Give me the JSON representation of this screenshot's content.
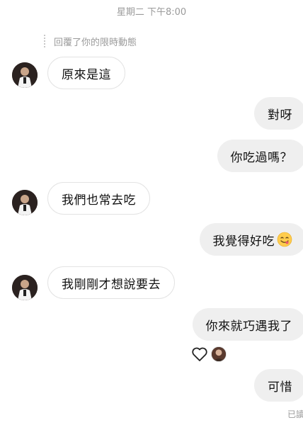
{
  "header": {
    "timestamp": "星期二 下午8:00"
  },
  "reply_note": "回覆了你的限時動態",
  "messages": [
    {
      "side": "in",
      "text": "原來是這"
    },
    {
      "side": "out",
      "text": "對呀"
    },
    {
      "side": "out",
      "text": "你吃過嗎？"
    },
    {
      "side": "in",
      "text": "我們也常去吃"
    },
    {
      "side": "out",
      "text": "我覺得好吃",
      "emoji": "yum-face-emoji"
    },
    {
      "side": "in",
      "text": "我剛剛才想說要去"
    },
    {
      "side": "out",
      "text": "你來就巧遇我了"
    },
    {
      "side": "out",
      "text": "可惜"
    }
  ],
  "reactions": {
    "icon": "heart-outline-icon"
  },
  "status": {
    "seen": "已讀"
  },
  "colors": {
    "outgoing_bubble": "#efefef",
    "incoming_border": "#e3e3e3",
    "meta_text": "#9a9a9a"
  }
}
